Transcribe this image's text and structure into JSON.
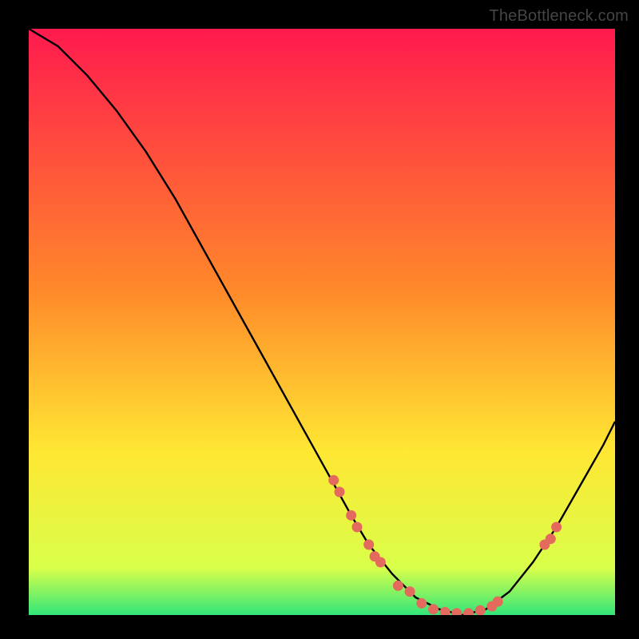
{
  "watermark": "TheBottleneck.com",
  "colors": {
    "gradient_top": "#ff1a4e",
    "gradient_mid": "#ffe733",
    "gradient_bottom": "#32e67a",
    "curve": "#000000",
    "marker": "#e46a5e",
    "background": "#000000"
  },
  "chart_data": {
    "type": "line",
    "title": "",
    "xlabel": "",
    "ylabel": "",
    "xlim": [
      0,
      100
    ],
    "ylim": [
      0,
      100
    ],
    "series": [
      {
        "name": "bottleneck-curve",
        "x": [
          0,
          5,
          10,
          15,
          20,
          25,
          30,
          35,
          40,
          45,
          50,
          55,
          58,
          62,
          66,
          70,
          74,
          78,
          82,
          86,
          90,
          94,
          98,
          100
        ],
        "y": [
          100,
          97,
          92,
          86,
          79,
          71,
          62,
          53,
          44,
          35,
          26,
          17,
          12,
          7,
          3,
          1,
          0,
          1,
          4,
          9,
          15,
          22,
          29,
          33
        ]
      }
    ],
    "markers": [
      {
        "x": 52,
        "y": 23
      },
      {
        "x": 53,
        "y": 21
      },
      {
        "x": 55,
        "y": 17
      },
      {
        "x": 56,
        "y": 15
      },
      {
        "x": 58,
        "y": 12
      },
      {
        "x": 59,
        "y": 10
      },
      {
        "x": 60,
        "y": 9
      },
      {
        "x": 63,
        "y": 5
      },
      {
        "x": 65,
        "y": 4
      },
      {
        "x": 67,
        "y": 2
      },
      {
        "x": 69,
        "y": 1
      },
      {
        "x": 71,
        "y": 0.5
      },
      {
        "x": 73,
        "y": 0.3
      },
      {
        "x": 75,
        "y": 0.3
      },
      {
        "x": 77,
        "y": 0.8
      },
      {
        "x": 79,
        "y": 1.5
      },
      {
        "x": 80,
        "y": 2.3
      },
      {
        "x": 88,
        "y": 12
      },
      {
        "x": 89,
        "y": 13
      },
      {
        "x": 90,
        "y": 15
      }
    ]
  }
}
